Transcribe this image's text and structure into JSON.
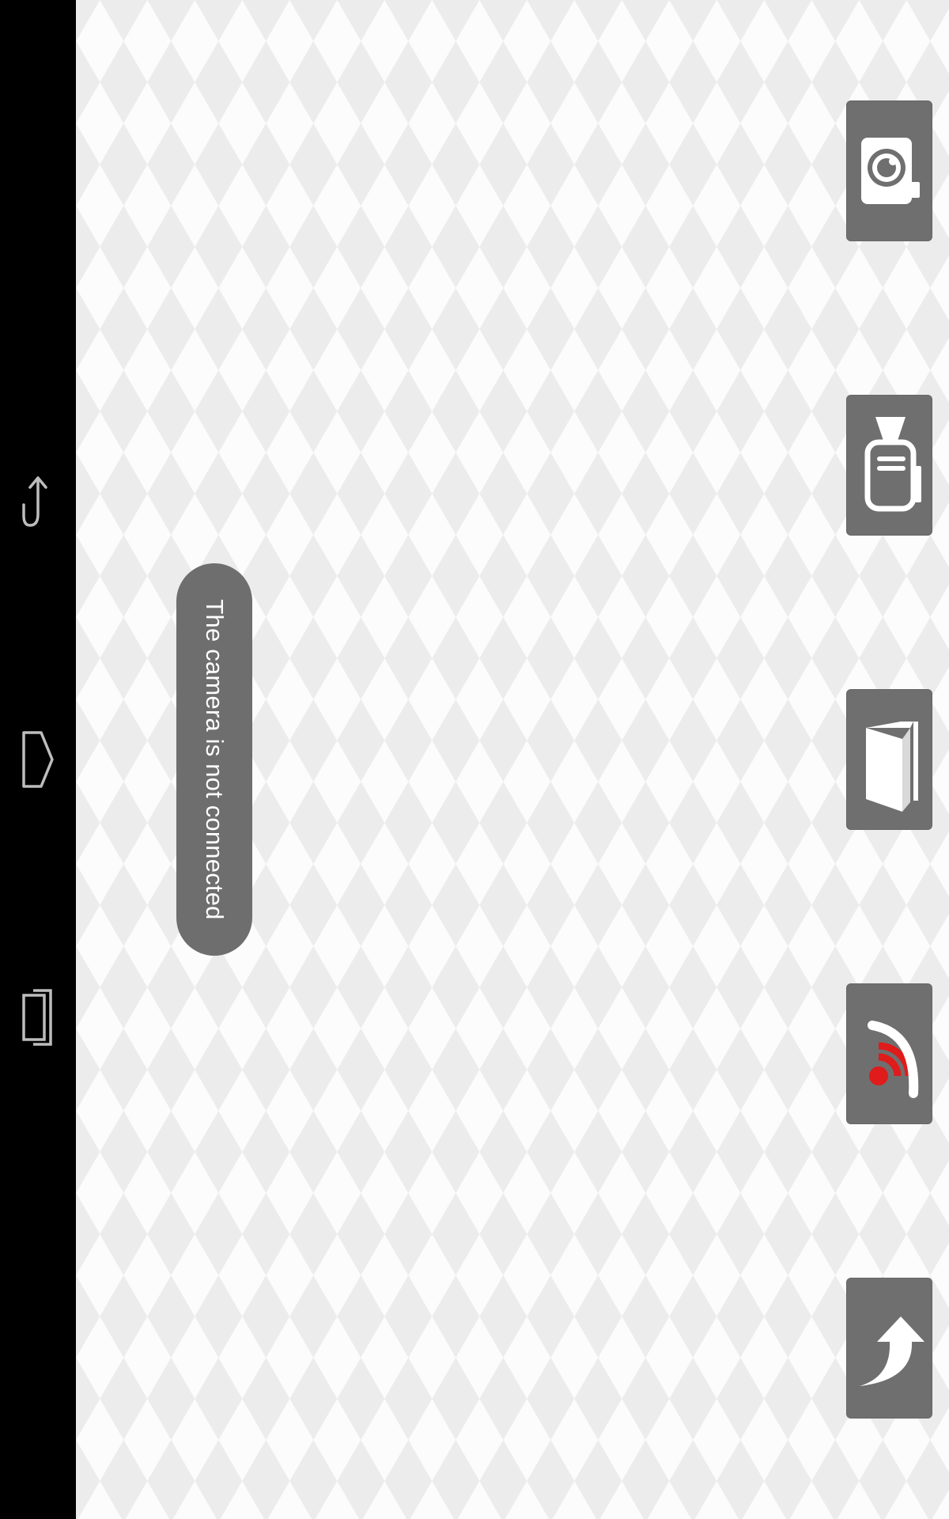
{
  "toast": {
    "message": "The camera is not connected"
  },
  "side_buttons": [
    {
      "id": "capture",
      "icon": "camera-icon"
    },
    {
      "id": "remote",
      "icon": "remote-control-icon"
    },
    {
      "id": "gallery",
      "icon": "gallery-book-icon"
    },
    {
      "id": "live",
      "icon": "live-broadcast-icon"
    },
    {
      "id": "share",
      "icon": "share-arrow-icon"
    }
  ],
  "nav_bar": [
    {
      "id": "back",
      "icon": "back-icon"
    },
    {
      "id": "home",
      "icon": "home-icon"
    },
    {
      "id": "recents",
      "icon": "recent-apps-icon"
    }
  ],
  "colors": {
    "button_bg": "#6f6f6f",
    "toast_bg": "#6e6e6e",
    "accent_red": "#e01b1b",
    "navbar_bg": "#000000"
  }
}
